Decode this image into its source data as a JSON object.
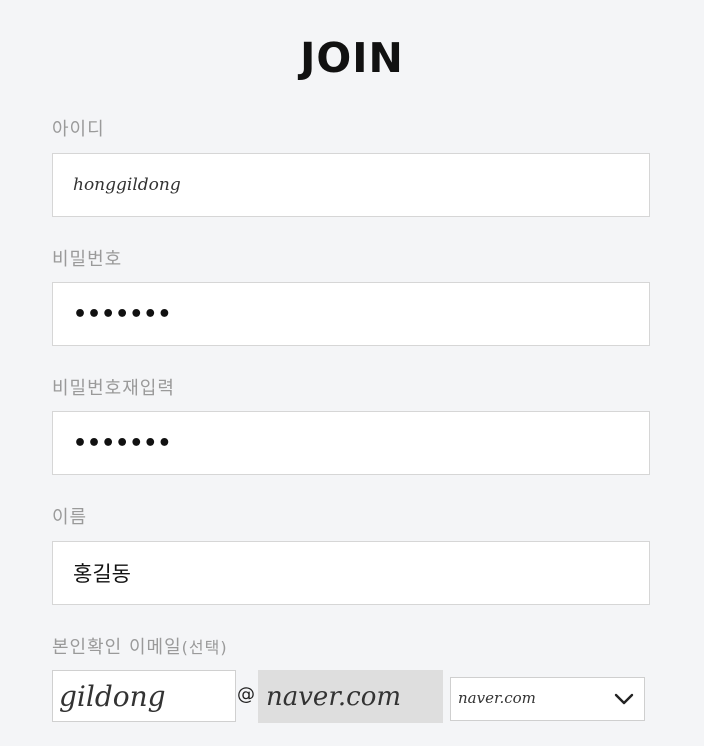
{
  "page": {
    "title": "JOIN"
  },
  "form": {
    "userid": {
      "label": "아이디",
      "value": "honggildong"
    },
    "password": {
      "label": "비밀번호",
      "value": "•••••••"
    },
    "password_confirm": {
      "label": "비밀번호재입력",
      "value": "•••••••"
    },
    "name": {
      "label": "이름",
      "value": "홍길동"
    },
    "email": {
      "label": "본인확인 이메일",
      "label_suffix": "(선택)",
      "id_value": "gildong",
      "at_symbol": "@",
      "domain_value": "naver.com",
      "select_value": "naver.com",
      "select_icon": "chevron-down-icon"
    }
  }
}
